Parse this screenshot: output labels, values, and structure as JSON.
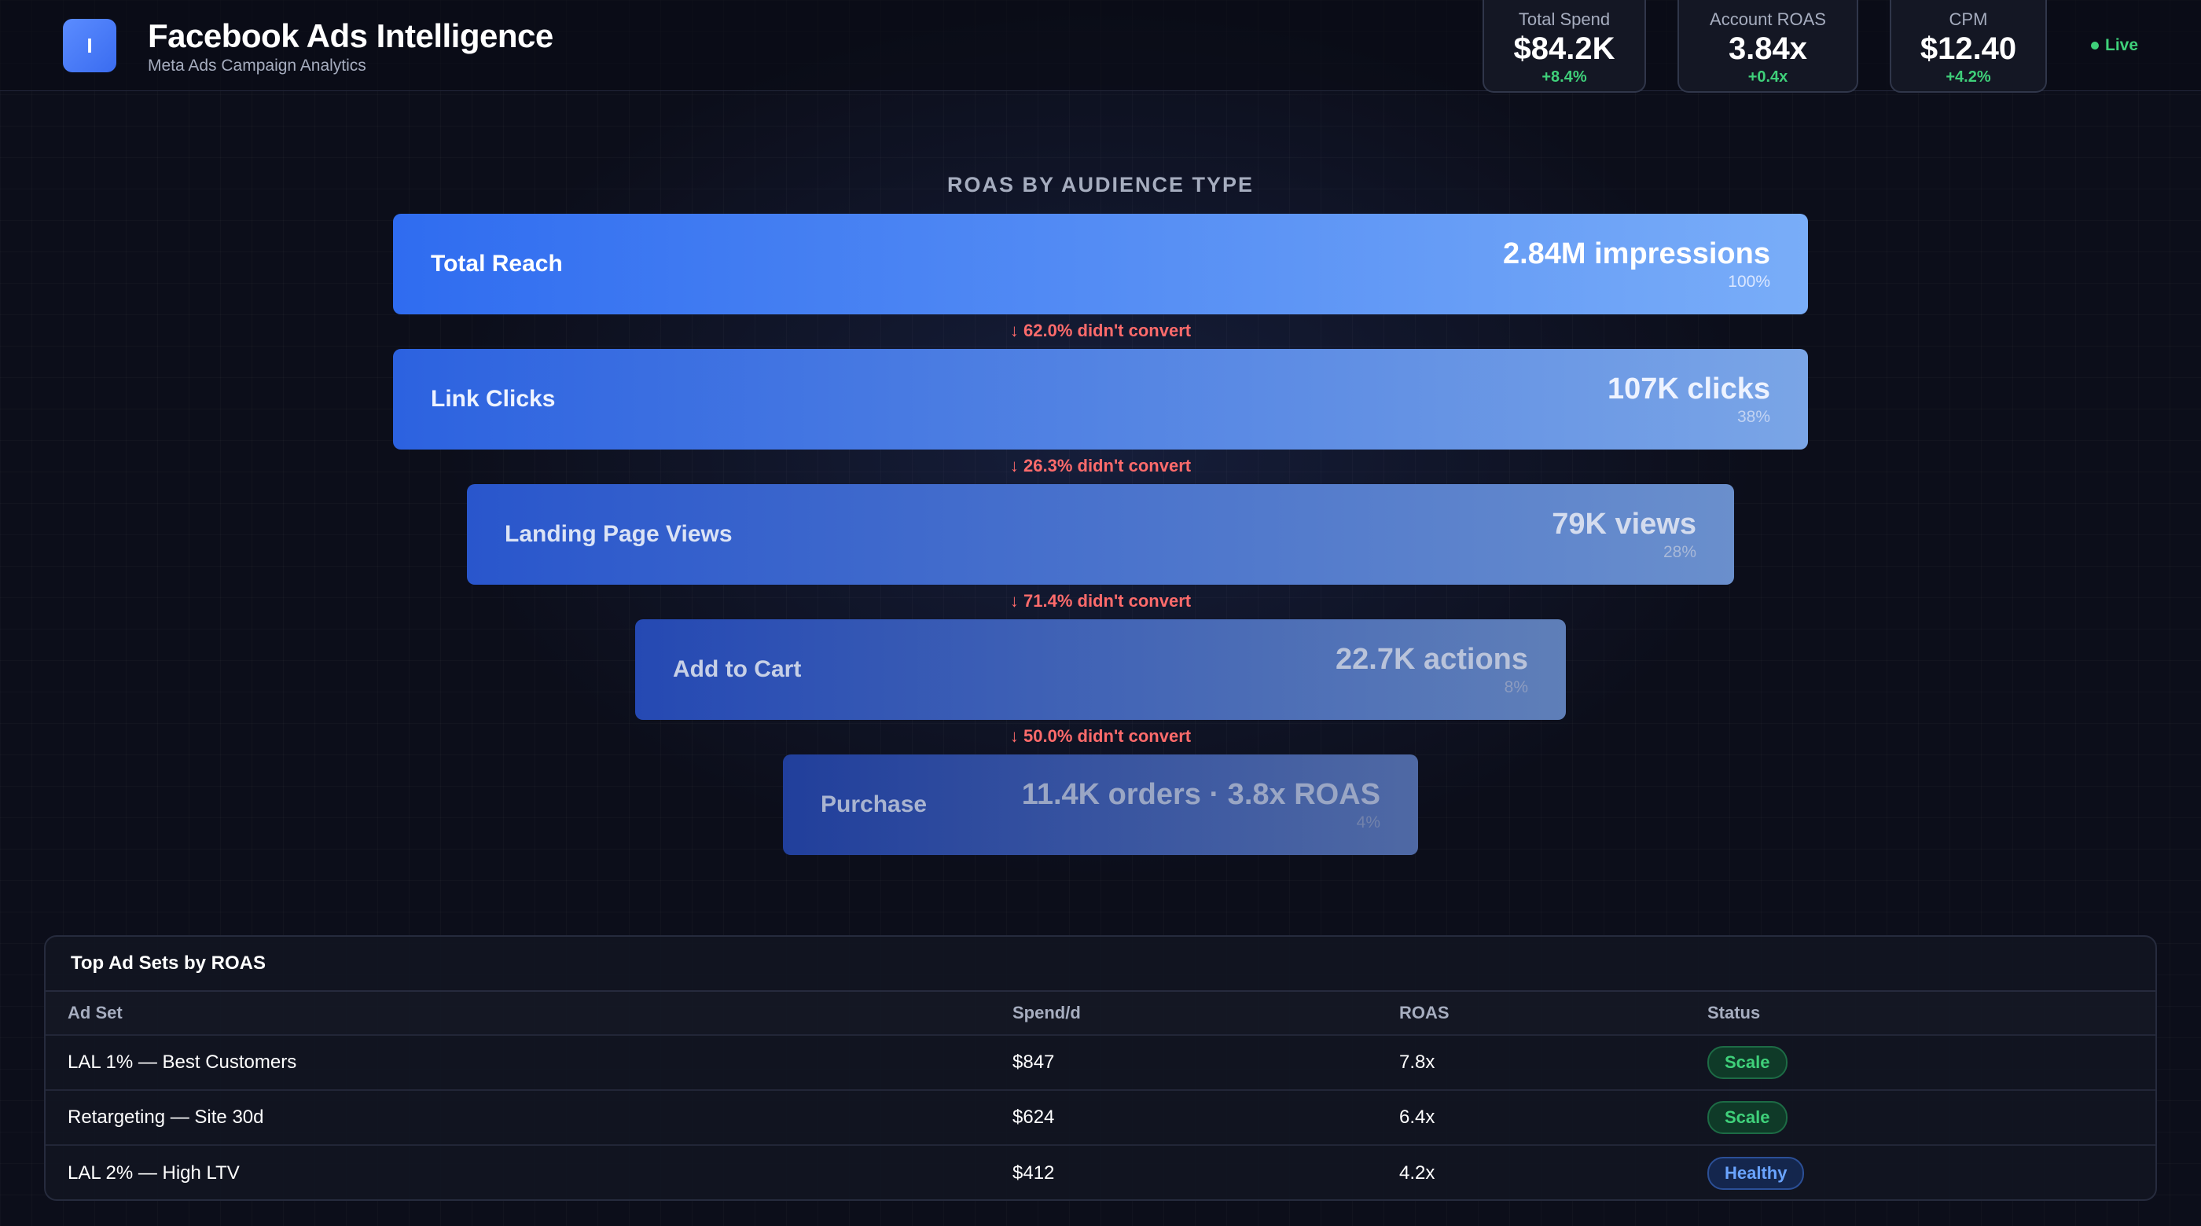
{
  "app": {
    "logo_letter": "I",
    "title": "Facebook Ads Intelligence",
    "subtitle": "Meta Ads Campaign Analytics"
  },
  "kpis": [
    {
      "label": "Total Spend",
      "value": "$84.2K",
      "delta": "+8.4%"
    },
    {
      "label": "Account ROAS",
      "value": "3.84x",
      "delta": "+0.4x"
    },
    {
      "label": "CPM",
      "value": "$12.40",
      "delta": "+4.2%"
    }
  ],
  "status": {
    "live_label": "Live"
  },
  "funnel": {
    "title": "ROAS BY AUDIENCE TYPE",
    "stages": [
      {
        "label": "Total Reach",
        "value": "2.84M impressions",
        "pct": "100%"
      },
      {
        "label": "Link Clicks",
        "value": "107K clicks",
        "pct": "38%"
      },
      {
        "label": "Landing Page Views",
        "value": "79K views",
        "pct": "28%"
      },
      {
        "label": "Add to Cart",
        "value": "22.7K actions",
        "pct": "8%"
      },
      {
        "label": "Purchase",
        "value": "11.4K orders · 3.8x ROAS",
        "pct": "4%"
      }
    ],
    "dropoffs": [
      "↓ 62.0% didn't convert",
      "↓ 26.3% didn't convert",
      "↓ 71.4% didn't convert",
      "↓ 50.0% didn't convert"
    ]
  },
  "table": {
    "title": "Top Ad Sets by ROAS",
    "columns": [
      "Ad Set",
      "Spend/d",
      "ROAS",
      "Status"
    ],
    "rows": [
      {
        "ad_set": "LAL 1% — Best Customers",
        "spend": "$847",
        "roas": "7.8x",
        "status": "Scale"
      },
      {
        "ad_set": "Retargeting — Site 30d",
        "spend": "$624",
        "roas": "6.4x",
        "status": "Scale"
      },
      {
        "ad_set": "LAL 2% — High LTV",
        "spend": "$412",
        "roas": "4.2x",
        "status": "Healthy"
      }
    ]
  },
  "colors": {
    "accent": "#3a6cf0",
    "positive": "#3fd07a",
    "negative": "#ff6b6b",
    "healthy": "#6aa4ff"
  }
}
